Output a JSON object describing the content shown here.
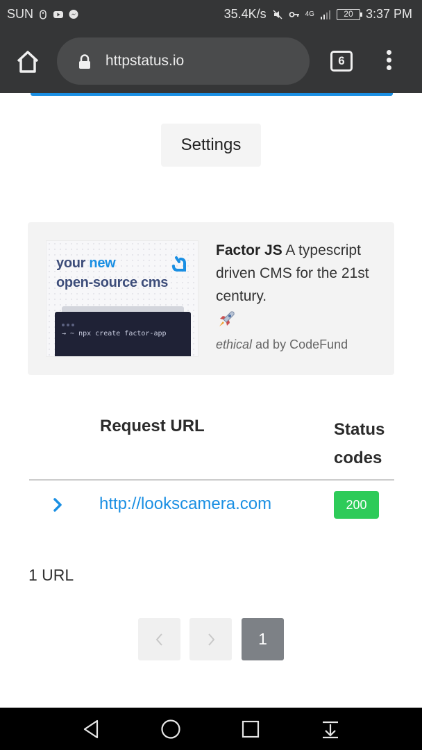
{
  "status_bar": {
    "carrier": "SUN",
    "speed": "35.4K/s",
    "network": "4G",
    "battery": "20",
    "time": "3:37 PM"
  },
  "browser": {
    "url": "httpstatus.io",
    "tab_count": "6"
  },
  "settings": {
    "label": "Settings"
  },
  "ad": {
    "image_headline_1": "your ",
    "image_headline_new": "new",
    "image_headline_2": "open-source cms",
    "image_terminal": "→ ~ npx create factor-app",
    "product": "Factor JS",
    "tagline": " A typescript driven CMS for the 21st century.",
    "credit_em": "ethical",
    "credit_rest": " ad by CodeFund"
  },
  "table": {
    "col_url": "Request URL",
    "col_status_1": "Status",
    "col_status_2": "codes",
    "rows": [
      {
        "url": "http://lookscamera.com",
        "status": "200"
      }
    ]
  },
  "summary": {
    "count": "1 URL"
  },
  "pagination": {
    "current": "1"
  },
  "colors": {
    "accent": "#1a8fe3",
    "success": "#2ecb59",
    "toolbar": "#353637"
  }
}
